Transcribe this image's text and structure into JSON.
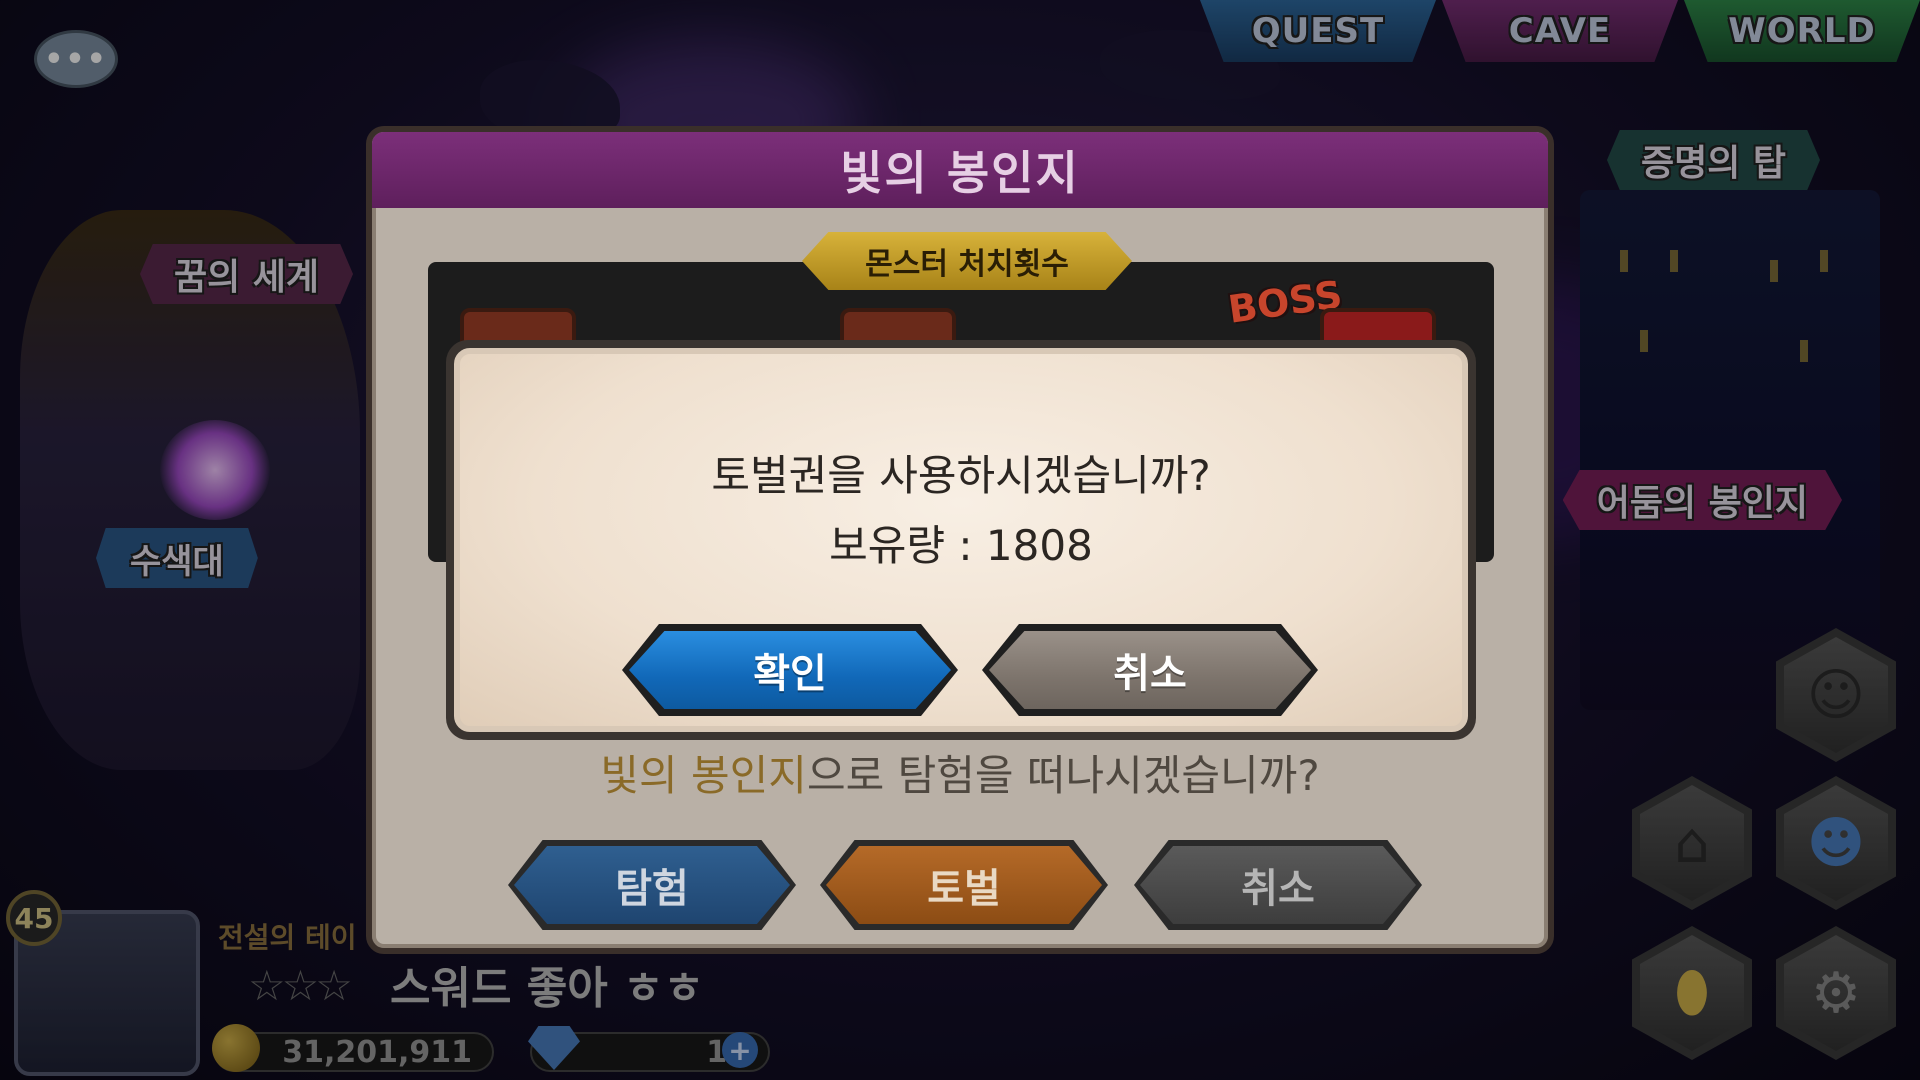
{
  "top_tabs": [
    {
      "label": "QUEST"
    },
    {
      "label": "CAVE"
    },
    {
      "label": "WORLD"
    }
  ],
  "chat": {
    "icon": "chat-bubble-icon",
    "text": "•••"
  },
  "map_labels": {
    "dream_world": "꿈의 세계",
    "water_zone": "수색대",
    "tower_of_proof": "증명의 탑",
    "dark_seal": "어둠의 봉인지"
  },
  "player": {
    "level": "45",
    "guild": "전설의 테이",
    "stars": "☆☆☆",
    "name": "스워드 좋아 ㅎㅎ",
    "gold": "31,201,911",
    "gems": "14",
    "gem_plus": "+"
  },
  "outer_dialog": {
    "title": "빛의 봉인지",
    "kill_count_label": "몬스터 처치횟수",
    "boss_tag": "BOSS",
    "question_highlight": "빛의 봉인지",
    "question_rest": "으로 탐험을 떠나시겠습니까?",
    "buttons": {
      "explore": "탐험",
      "punish": "토벌",
      "cancel": "취소"
    }
  },
  "confirm_modal": {
    "message": "토벌권을 사용하시겠습니까?",
    "amount": "보유량 : 1808",
    "ok_label": "확인",
    "cancel_label": "취소"
  },
  "hex_menu": [
    {
      "icon": "character-icon"
    },
    {
      "icon": "home-icon"
    },
    {
      "icon": "friends-icon"
    },
    {
      "icon": "egg-icon"
    },
    {
      "icon": "gear-icon"
    }
  ],
  "colors": {
    "ok_button": "#1168b8",
    "cancel_button": "#7d746c",
    "dialog_title_bar": "#7c2f7a",
    "punish_button": "#b56a28"
  }
}
